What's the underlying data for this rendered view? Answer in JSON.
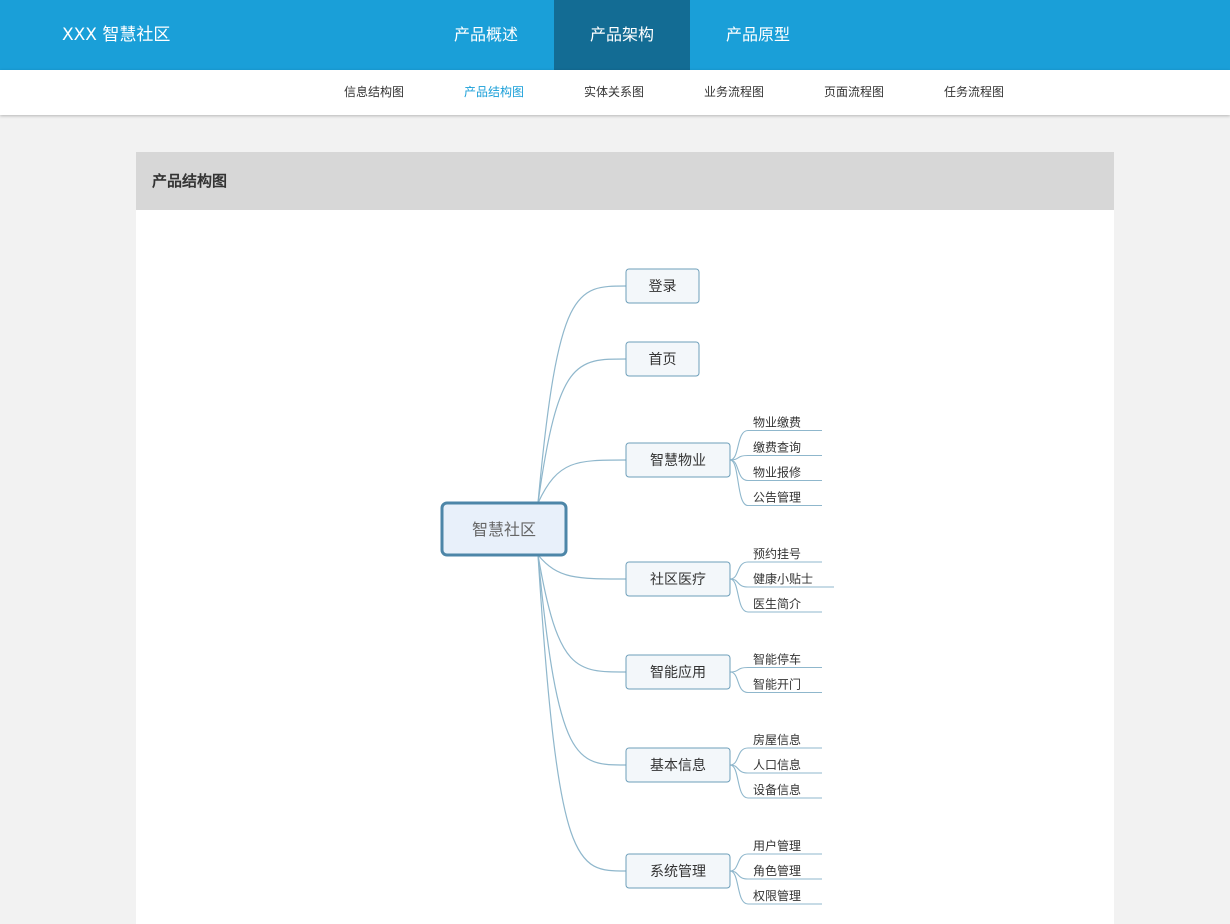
{
  "header": {
    "brand": "XXX 智慧社区",
    "tabs": [
      {
        "label": "产品概述"
      },
      {
        "label": "产品架构"
      },
      {
        "label": "产品原型"
      }
    ],
    "active_tab": 1
  },
  "subnav": {
    "items": [
      {
        "label": "信息结构图"
      },
      {
        "label": "产品结构图"
      },
      {
        "label": "实体关系图"
      },
      {
        "label": "业务流程图"
      },
      {
        "label": "页面流程图"
      },
      {
        "label": "任务流程图"
      }
    ],
    "active_item": 1
  },
  "panel": {
    "title": "产品结构图"
  },
  "mindmap": {
    "root": "智慧社区",
    "branches": [
      {
        "label": "登录",
        "children": []
      },
      {
        "label": "首页",
        "children": []
      },
      {
        "label": "智慧物业",
        "children": [
          "物业缴费",
          "缴费查询",
          "物业报修",
          "公告管理"
        ]
      },
      {
        "label": "社区医疗",
        "children": [
          "预约挂号",
          "健康小贴士",
          "医生简介"
        ]
      },
      {
        "label": "智能应用",
        "children": [
          "智能停车",
          "智能开门"
        ]
      },
      {
        "label": "基本信息",
        "children": [
          "房屋信息",
          "人口信息",
          "设备信息"
        ]
      },
      {
        "label": "系统管理",
        "children": [
          "用户管理",
          "角色管理",
          "权限管理"
        ]
      }
    ],
    "colors": {
      "line": "#8fb7cc",
      "node_border": "#6e9fba",
      "node_fill": "#f3f7fa",
      "root_border": "#4d86a8",
      "root_fill": "#e8f0fa",
      "root_text": "#666666",
      "text": "#333333"
    }
  }
}
